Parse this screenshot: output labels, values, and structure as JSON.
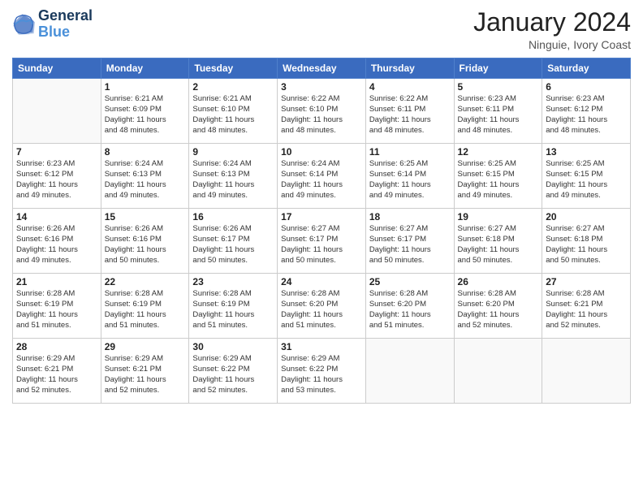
{
  "logo": {
    "line1": "General",
    "line2": "Blue"
  },
  "title": "January 2024",
  "location": "Ninguie, Ivory Coast",
  "days_of_week": [
    "Sunday",
    "Monday",
    "Tuesday",
    "Wednesday",
    "Thursday",
    "Friday",
    "Saturday"
  ],
  "weeks": [
    [
      {
        "day": "",
        "info": ""
      },
      {
        "day": "1",
        "info": "Sunrise: 6:21 AM\nSunset: 6:09 PM\nDaylight: 11 hours\nand 48 minutes."
      },
      {
        "day": "2",
        "info": "Sunrise: 6:21 AM\nSunset: 6:10 PM\nDaylight: 11 hours\nand 48 minutes."
      },
      {
        "day": "3",
        "info": "Sunrise: 6:22 AM\nSunset: 6:10 PM\nDaylight: 11 hours\nand 48 minutes."
      },
      {
        "day": "4",
        "info": "Sunrise: 6:22 AM\nSunset: 6:11 PM\nDaylight: 11 hours\nand 48 minutes."
      },
      {
        "day": "5",
        "info": "Sunrise: 6:23 AM\nSunset: 6:11 PM\nDaylight: 11 hours\nand 48 minutes."
      },
      {
        "day": "6",
        "info": "Sunrise: 6:23 AM\nSunset: 6:12 PM\nDaylight: 11 hours\nand 48 minutes."
      }
    ],
    [
      {
        "day": "7",
        "info": "Sunrise: 6:23 AM\nSunset: 6:12 PM\nDaylight: 11 hours\nand 49 minutes."
      },
      {
        "day": "8",
        "info": "Sunrise: 6:24 AM\nSunset: 6:13 PM\nDaylight: 11 hours\nand 49 minutes."
      },
      {
        "day": "9",
        "info": "Sunrise: 6:24 AM\nSunset: 6:13 PM\nDaylight: 11 hours\nand 49 minutes."
      },
      {
        "day": "10",
        "info": "Sunrise: 6:24 AM\nSunset: 6:14 PM\nDaylight: 11 hours\nand 49 minutes."
      },
      {
        "day": "11",
        "info": "Sunrise: 6:25 AM\nSunset: 6:14 PM\nDaylight: 11 hours\nand 49 minutes."
      },
      {
        "day": "12",
        "info": "Sunrise: 6:25 AM\nSunset: 6:15 PM\nDaylight: 11 hours\nand 49 minutes."
      },
      {
        "day": "13",
        "info": "Sunrise: 6:25 AM\nSunset: 6:15 PM\nDaylight: 11 hours\nand 49 minutes."
      }
    ],
    [
      {
        "day": "14",
        "info": "Sunrise: 6:26 AM\nSunset: 6:16 PM\nDaylight: 11 hours\nand 49 minutes."
      },
      {
        "day": "15",
        "info": "Sunrise: 6:26 AM\nSunset: 6:16 PM\nDaylight: 11 hours\nand 50 minutes."
      },
      {
        "day": "16",
        "info": "Sunrise: 6:26 AM\nSunset: 6:17 PM\nDaylight: 11 hours\nand 50 minutes."
      },
      {
        "day": "17",
        "info": "Sunrise: 6:27 AM\nSunset: 6:17 PM\nDaylight: 11 hours\nand 50 minutes."
      },
      {
        "day": "18",
        "info": "Sunrise: 6:27 AM\nSunset: 6:17 PM\nDaylight: 11 hours\nand 50 minutes."
      },
      {
        "day": "19",
        "info": "Sunrise: 6:27 AM\nSunset: 6:18 PM\nDaylight: 11 hours\nand 50 minutes."
      },
      {
        "day": "20",
        "info": "Sunrise: 6:27 AM\nSunset: 6:18 PM\nDaylight: 11 hours\nand 50 minutes."
      }
    ],
    [
      {
        "day": "21",
        "info": "Sunrise: 6:28 AM\nSunset: 6:19 PM\nDaylight: 11 hours\nand 51 minutes."
      },
      {
        "day": "22",
        "info": "Sunrise: 6:28 AM\nSunset: 6:19 PM\nDaylight: 11 hours\nand 51 minutes."
      },
      {
        "day": "23",
        "info": "Sunrise: 6:28 AM\nSunset: 6:19 PM\nDaylight: 11 hours\nand 51 minutes."
      },
      {
        "day": "24",
        "info": "Sunrise: 6:28 AM\nSunset: 6:20 PM\nDaylight: 11 hours\nand 51 minutes."
      },
      {
        "day": "25",
        "info": "Sunrise: 6:28 AM\nSunset: 6:20 PM\nDaylight: 11 hours\nand 51 minutes."
      },
      {
        "day": "26",
        "info": "Sunrise: 6:28 AM\nSunset: 6:20 PM\nDaylight: 11 hours\nand 52 minutes."
      },
      {
        "day": "27",
        "info": "Sunrise: 6:28 AM\nSunset: 6:21 PM\nDaylight: 11 hours\nand 52 minutes."
      }
    ],
    [
      {
        "day": "28",
        "info": "Sunrise: 6:29 AM\nSunset: 6:21 PM\nDaylight: 11 hours\nand 52 minutes."
      },
      {
        "day": "29",
        "info": "Sunrise: 6:29 AM\nSunset: 6:21 PM\nDaylight: 11 hours\nand 52 minutes."
      },
      {
        "day": "30",
        "info": "Sunrise: 6:29 AM\nSunset: 6:22 PM\nDaylight: 11 hours\nand 52 minutes."
      },
      {
        "day": "31",
        "info": "Sunrise: 6:29 AM\nSunset: 6:22 PM\nDaylight: 11 hours\nand 53 minutes."
      },
      {
        "day": "",
        "info": ""
      },
      {
        "day": "",
        "info": ""
      },
      {
        "day": "",
        "info": ""
      }
    ]
  ]
}
